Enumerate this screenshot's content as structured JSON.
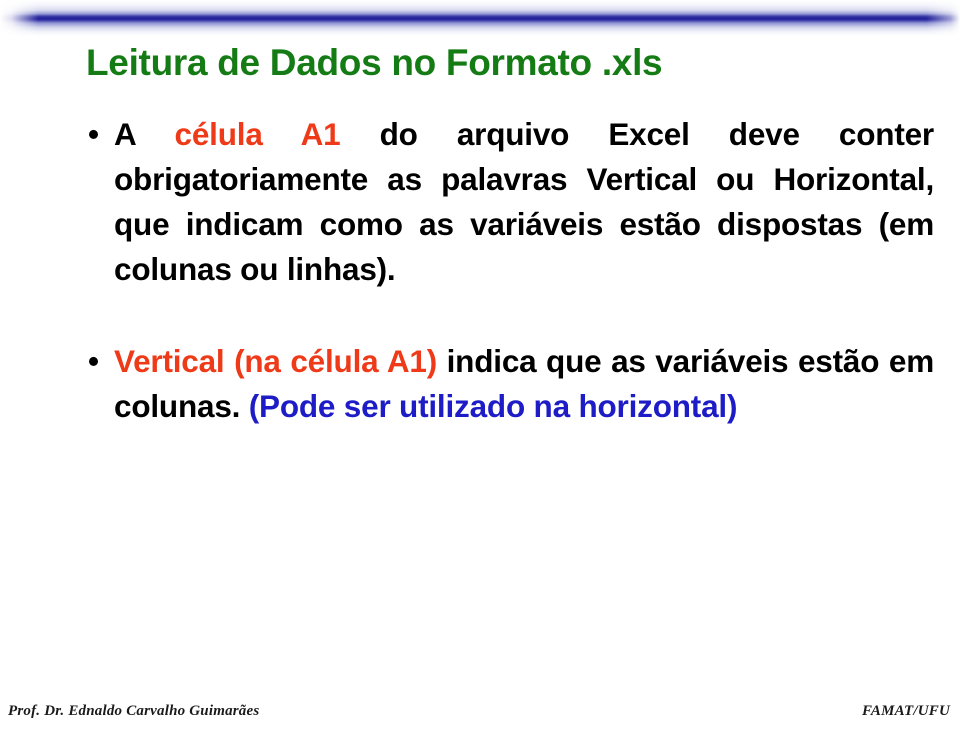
{
  "slide": {
    "title": "Leitura de Dados no Formato .xls",
    "title_color": "#157c15",
    "background_color": "#ffffff"
  },
  "header_band": {
    "accent_color": "#23219a",
    "fade_color": "#ffffff"
  },
  "colors": {
    "red": "#ee3a18",
    "blue": "#1d1cc6",
    "black": "#000000",
    "green": "#157c15",
    "navy": "#23219a"
  },
  "bullets": [
    {
      "marker": "•",
      "runs": [
        {
          "text": "A ",
          "color": "black"
        },
        {
          "text": "célula A1",
          "color": "red"
        },
        {
          "text": " do arquivo Excel deve conter obrigatoriamente as palavras Vertical ou Horizontal, que indicam como as variáveis estão dispostas (em colunas ou linhas).",
          "color": "black"
        }
      ],
      "plain_text": "A célula A1 do arquivo Excel deve conter obrigatoriamente as palavras Vertical ou Horizontal, que indicam como as variáveis estão dispostas (em colunas ou linhas)."
    },
    {
      "marker": "•",
      "runs": [
        {
          "text": "Vertical (na célula A1)",
          "color": "red"
        },
        {
          "text": " indica que as variáveis estão em colunas. ",
          "color": "black"
        },
        {
          "text": "(Pode ser utilizado na horizontal)",
          "color": "blue"
        }
      ],
      "plain_text": "Vertical (na célula A1) indica que as variáveis estão em colunas. (Pode ser utilizado na horizontal)"
    }
  ],
  "footer": {
    "left": "Prof. Dr. Ednaldo Carvalho Guimarães",
    "right": "FAMAT/UFU"
  }
}
